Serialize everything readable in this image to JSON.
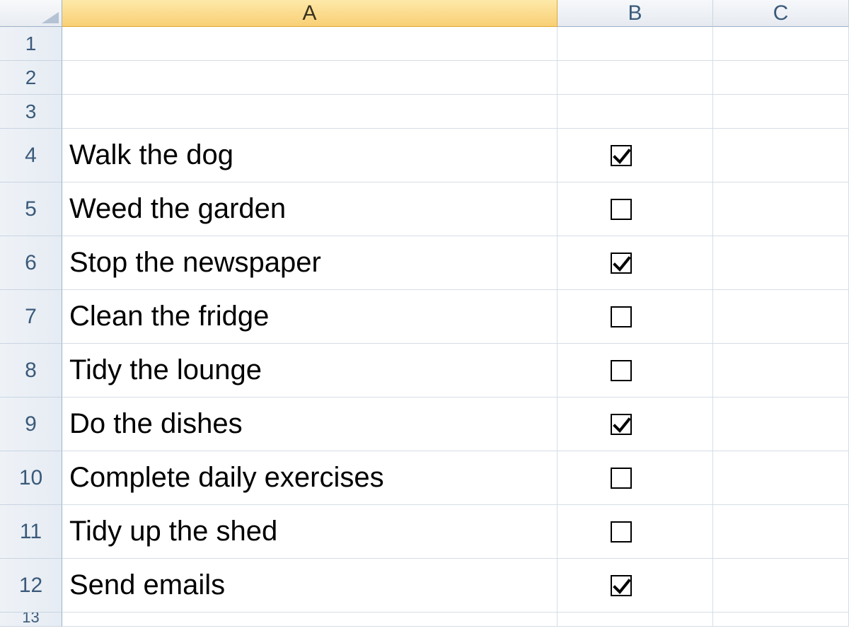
{
  "columns": [
    {
      "label": "A",
      "selected": true
    },
    {
      "label": "B",
      "selected": false
    },
    {
      "label": "C",
      "selected": false
    }
  ],
  "small_rows": [
    "1",
    "2",
    "3"
  ],
  "task_rows": [
    {
      "num": "4",
      "text": "Walk the dog",
      "checked": true
    },
    {
      "num": "5",
      "text": "Weed the garden",
      "checked": false
    },
    {
      "num": "6",
      "text": "Stop the newspaper",
      "checked": true
    },
    {
      "num": "7",
      "text": "Clean the fridge",
      "checked": false
    },
    {
      "num": "8",
      "text": "Tidy the lounge",
      "checked": false
    },
    {
      "num": "9",
      "text": "Do the dishes",
      "checked": true
    },
    {
      "num": "10",
      "text": "Complete daily exercises",
      "checked": false
    },
    {
      "num": "11",
      "text": "Tidy up the shed",
      "checked": false
    },
    {
      "num": "12",
      "text": "Send emails",
      "checked": true
    }
  ],
  "partial_row": "13"
}
